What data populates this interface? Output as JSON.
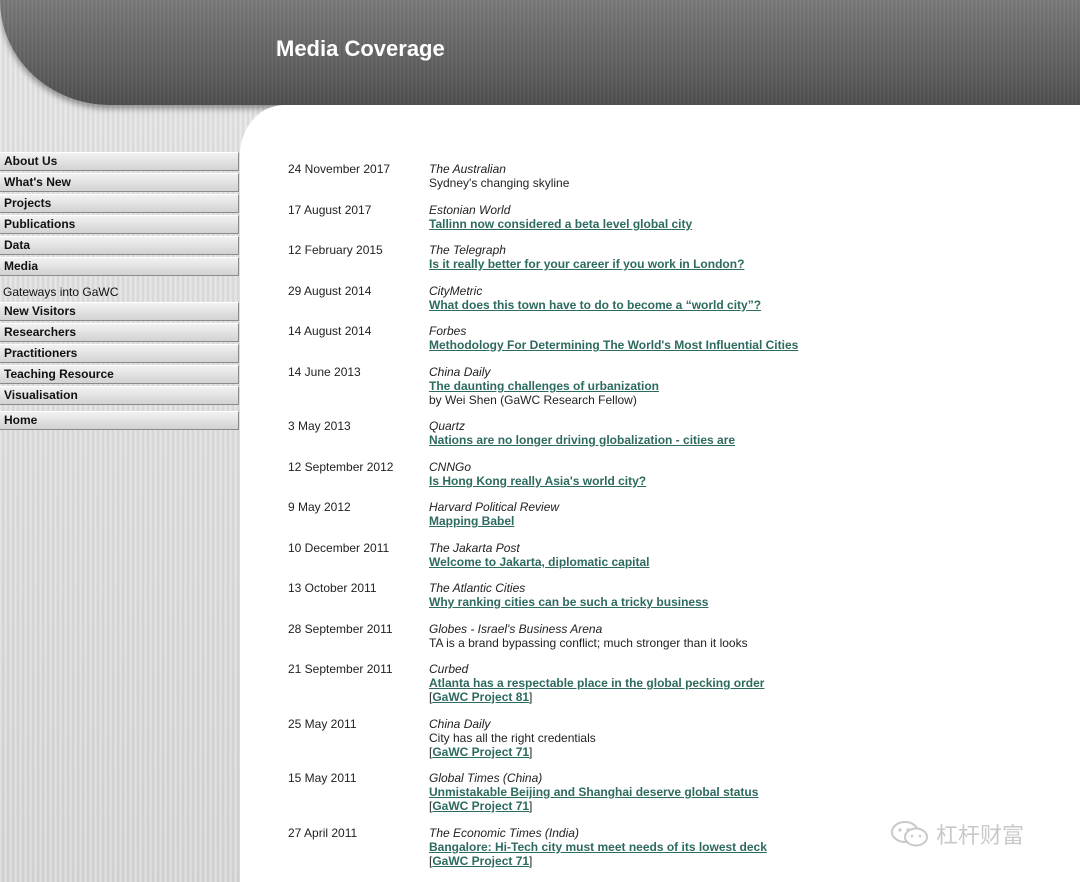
{
  "header": {
    "title": "Media Coverage"
  },
  "sidebar": {
    "main_items": [
      "About Us",
      "What's New",
      "Projects",
      "Publications",
      "Data",
      "Media"
    ],
    "gateways_label": "Gateways into GaWC",
    "gateway_items": [
      "New Visitors",
      "Researchers",
      "Practitioners",
      "Teaching Resource",
      "Visualisation"
    ],
    "home_label": "Home"
  },
  "entries": [
    {
      "date": "24 November 2017",
      "outlet": "The Australian",
      "lines": [
        {
          "text": "Sydney's changing skyline",
          "link": false
        }
      ]
    },
    {
      "date": "17 August 2017",
      "outlet": "Estonian World",
      "lines": [
        {
          "text": "Tallinn now considered a beta level global city",
          "link": true
        }
      ]
    },
    {
      "date": "12 February 2015",
      "outlet": "The Telegraph",
      "lines": [
        {
          "text": "Is it really better for your career if you work in London?",
          "link": true
        }
      ]
    },
    {
      "date": "29 August 2014",
      "outlet": "CityMetric",
      "lines": [
        {
          "text": "What does this town have to do to become a “world city”?",
          "link": true
        }
      ]
    },
    {
      "date": "14 August 2014",
      "outlet": "Forbes",
      "lines": [
        {
          "text": "Methodology For Determining The World's Most Influential Cities",
          "link": true
        }
      ]
    },
    {
      "date": "14 June 2013",
      "outlet": "China Daily",
      "lines": [
        {
          "text": "The daunting challenges of urbanization",
          "link": true
        },
        {
          "text": "by Wei Shen (GaWC Research Fellow)",
          "link": false
        }
      ]
    },
    {
      "date": "3 May 2013",
      "outlet": "Quartz",
      "lines": [
        {
          "text": "Nations are no longer driving globalization - cities are",
          "link": true
        }
      ]
    },
    {
      "date": "12 September 2012",
      "outlet": "CNNGo",
      "lines": [
        {
          "text": "Is Hong Kong really Asia's world city?",
          "link": true
        }
      ]
    },
    {
      "date": "9 May 2012",
      "outlet": "Harvard Political Review",
      "lines": [
        {
          "text": "Mapping Babel",
          "link": true
        }
      ]
    },
    {
      "date": "10 December 2011",
      "outlet": "The Jakarta Post",
      "lines": [
        {
          "text": "Welcome to Jakarta, diplomatic capital",
          "link": true
        }
      ]
    },
    {
      "date": "13 October 2011",
      "outlet": "The Atlantic Cities",
      "lines": [
        {
          "text": "Why ranking cities can be such a tricky business",
          "link": true
        }
      ]
    },
    {
      "date": "28 September 2011",
      "outlet": "Globes - Israel's Business Arena",
      "lines": [
        {
          "text": "TA is a brand bypassing conflict; much stronger than it looks",
          "link": false
        }
      ]
    },
    {
      "date": "21 September 2011",
      "outlet": "Curbed",
      "lines": [
        {
          "text": "Atlanta has a respectable place in the global pecking order",
          "link": true
        },
        {
          "text": "GaWC Project 81",
          "link": true,
          "bracket": true
        }
      ]
    },
    {
      "date": "25 May 2011",
      "outlet": "China Daily",
      "lines": [
        {
          "text": "City has all the right credentials",
          "link": false
        },
        {
          "text": "GaWC Project 71",
          "link": true,
          "bracket": true
        }
      ]
    },
    {
      "date": "15 May 2011",
      "outlet": "Global Times (China)",
      "lines": [
        {
          "text": "Unmistakable Beijing and Shanghai deserve global status",
          "link": true
        },
        {
          "text": "GaWC Project 71",
          "link": true,
          "bracket": true
        }
      ]
    },
    {
      "date": "27 April 2011",
      "outlet": "The Economic Times (India)",
      "lines": [
        {
          "text": "Bangalore: Hi-Tech city must meet needs of its lowest deck",
          "link": true
        },
        {
          "text": "GaWC Project 71",
          "link": true,
          "bracket": true
        }
      ]
    }
  ],
  "watermark": {
    "text": "杠杆财富",
    "icon": "wechat-icon"
  }
}
